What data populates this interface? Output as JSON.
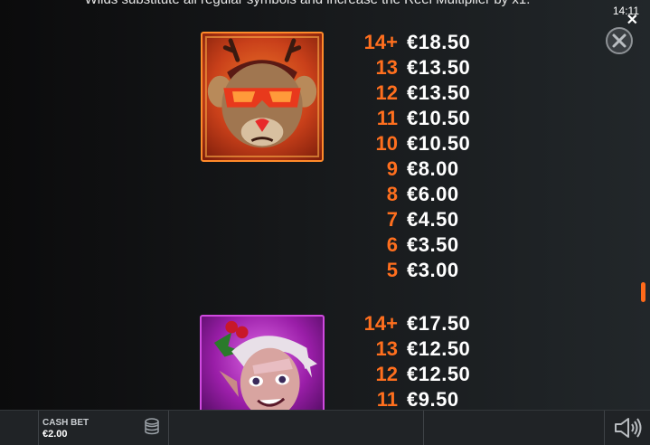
{
  "header": {
    "intro_text": "Wilds substitute all regular symbols and increase the Reel Multiplier by x1.",
    "clock": "14:11",
    "close_small_glyph": "✕"
  },
  "paytable": [
    {
      "symbol_icon": "reindeer-symbol-icon",
      "rows": [
        {
          "count": "14+",
          "amount": "€18.50"
        },
        {
          "count": "13",
          "amount": "€13.50"
        },
        {
          "count": "12",
          "amount": "€13.50"
        },
        {
          "count": "11",
          "amount": "€10.50"
        },
        {
          "count": "10",
          "amount": "€10.50"
        },
        {
          "count": "9",
          "amount": "€8.00"
        },
        {
          "count": "8",
          "amount": "€6.00"
        },
        {
          "count": "7",
          "amount": "€4.50"
        },
        {
          "count": "6",
          "amount": "€3.50"
        },
        {
          "count": "5",
          "amount": "€3.00"
        }
      ]
    },
    {
      "symbol_icon": "elf-symbol-icon",
      "rows": [
        {
          "count": "14+",
          "amount": "€17.50"
        },
        {
          "count": "13",
          "amount": "€12.50"
        },
        {
          "count": "12",
          "amount": "€12.50"
        },
        {
          "count": "11",
          "amount": "€9.50"
        }
      ]
    }
  ],
  "bottom_bar": {
    "cash_bet_label": "CASH BET",
    "cash_bet_value": "€2.00",
    "coins_icon": "coins-icon",
    "sound_icon": "speaker-icon"
  },
  "colors": {
    "count_accent": "#ff6f1e",
    "scroll_thumb": "#ff6a1a",
    "background": "#16181a"
  },
  "scroll": {
    "position_fraction": 0.69
  }
}
